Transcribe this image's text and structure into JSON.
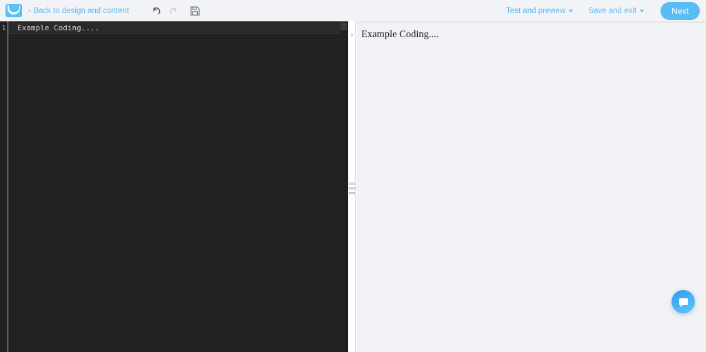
{
  "app": {
    "logo_icon": "envelope-icon",
    "brand_color": "#5bc0f2"
  },
  "topbar": {
    "back_link": {
      "chevron": "‹",
      "label": "Back to design and content"
    },
    "history": [
      {
        "name": "undo",
        "icon": "undo-arrow-icon",
        "enabled": true
      },
      {
        "name": "redo",
        "icon": "redo-arrow-icon",
        "enabled": false
      },
      {
        "name": "save",
        "icon": "floppy-disk-icon",
        "enabled": true
      }
    ],
    "menus": [
      {
        "label": "Test and preview",
        "icon": "chevron-down-icon"
      },
      {
        "label": "Save and exit",
        "icon": "chevron-down-icon"
      }
    ],
    "next_label": "Next"
  },
  "editor": {
    "line_numbers": [
      "1"
    ],
    "lines": [
      "Example Coding...."
    ],
    "background": "#212121",
    "text_color": "#d4d4d4"
  },
  "divider": {
    "collapse_icon": "chevron-right-icon",
    "collapse_glyph": "›",
    "drag_handle_icon": "drag-handle-icon"
  },
  "preview": {
    "content": "Example Coding....",
    "background": "#f1f2f6"
  },
  "chat": {
    "icon": "speech-bubble-icon",
    "accent": "#2f9bf2"
  }
}
